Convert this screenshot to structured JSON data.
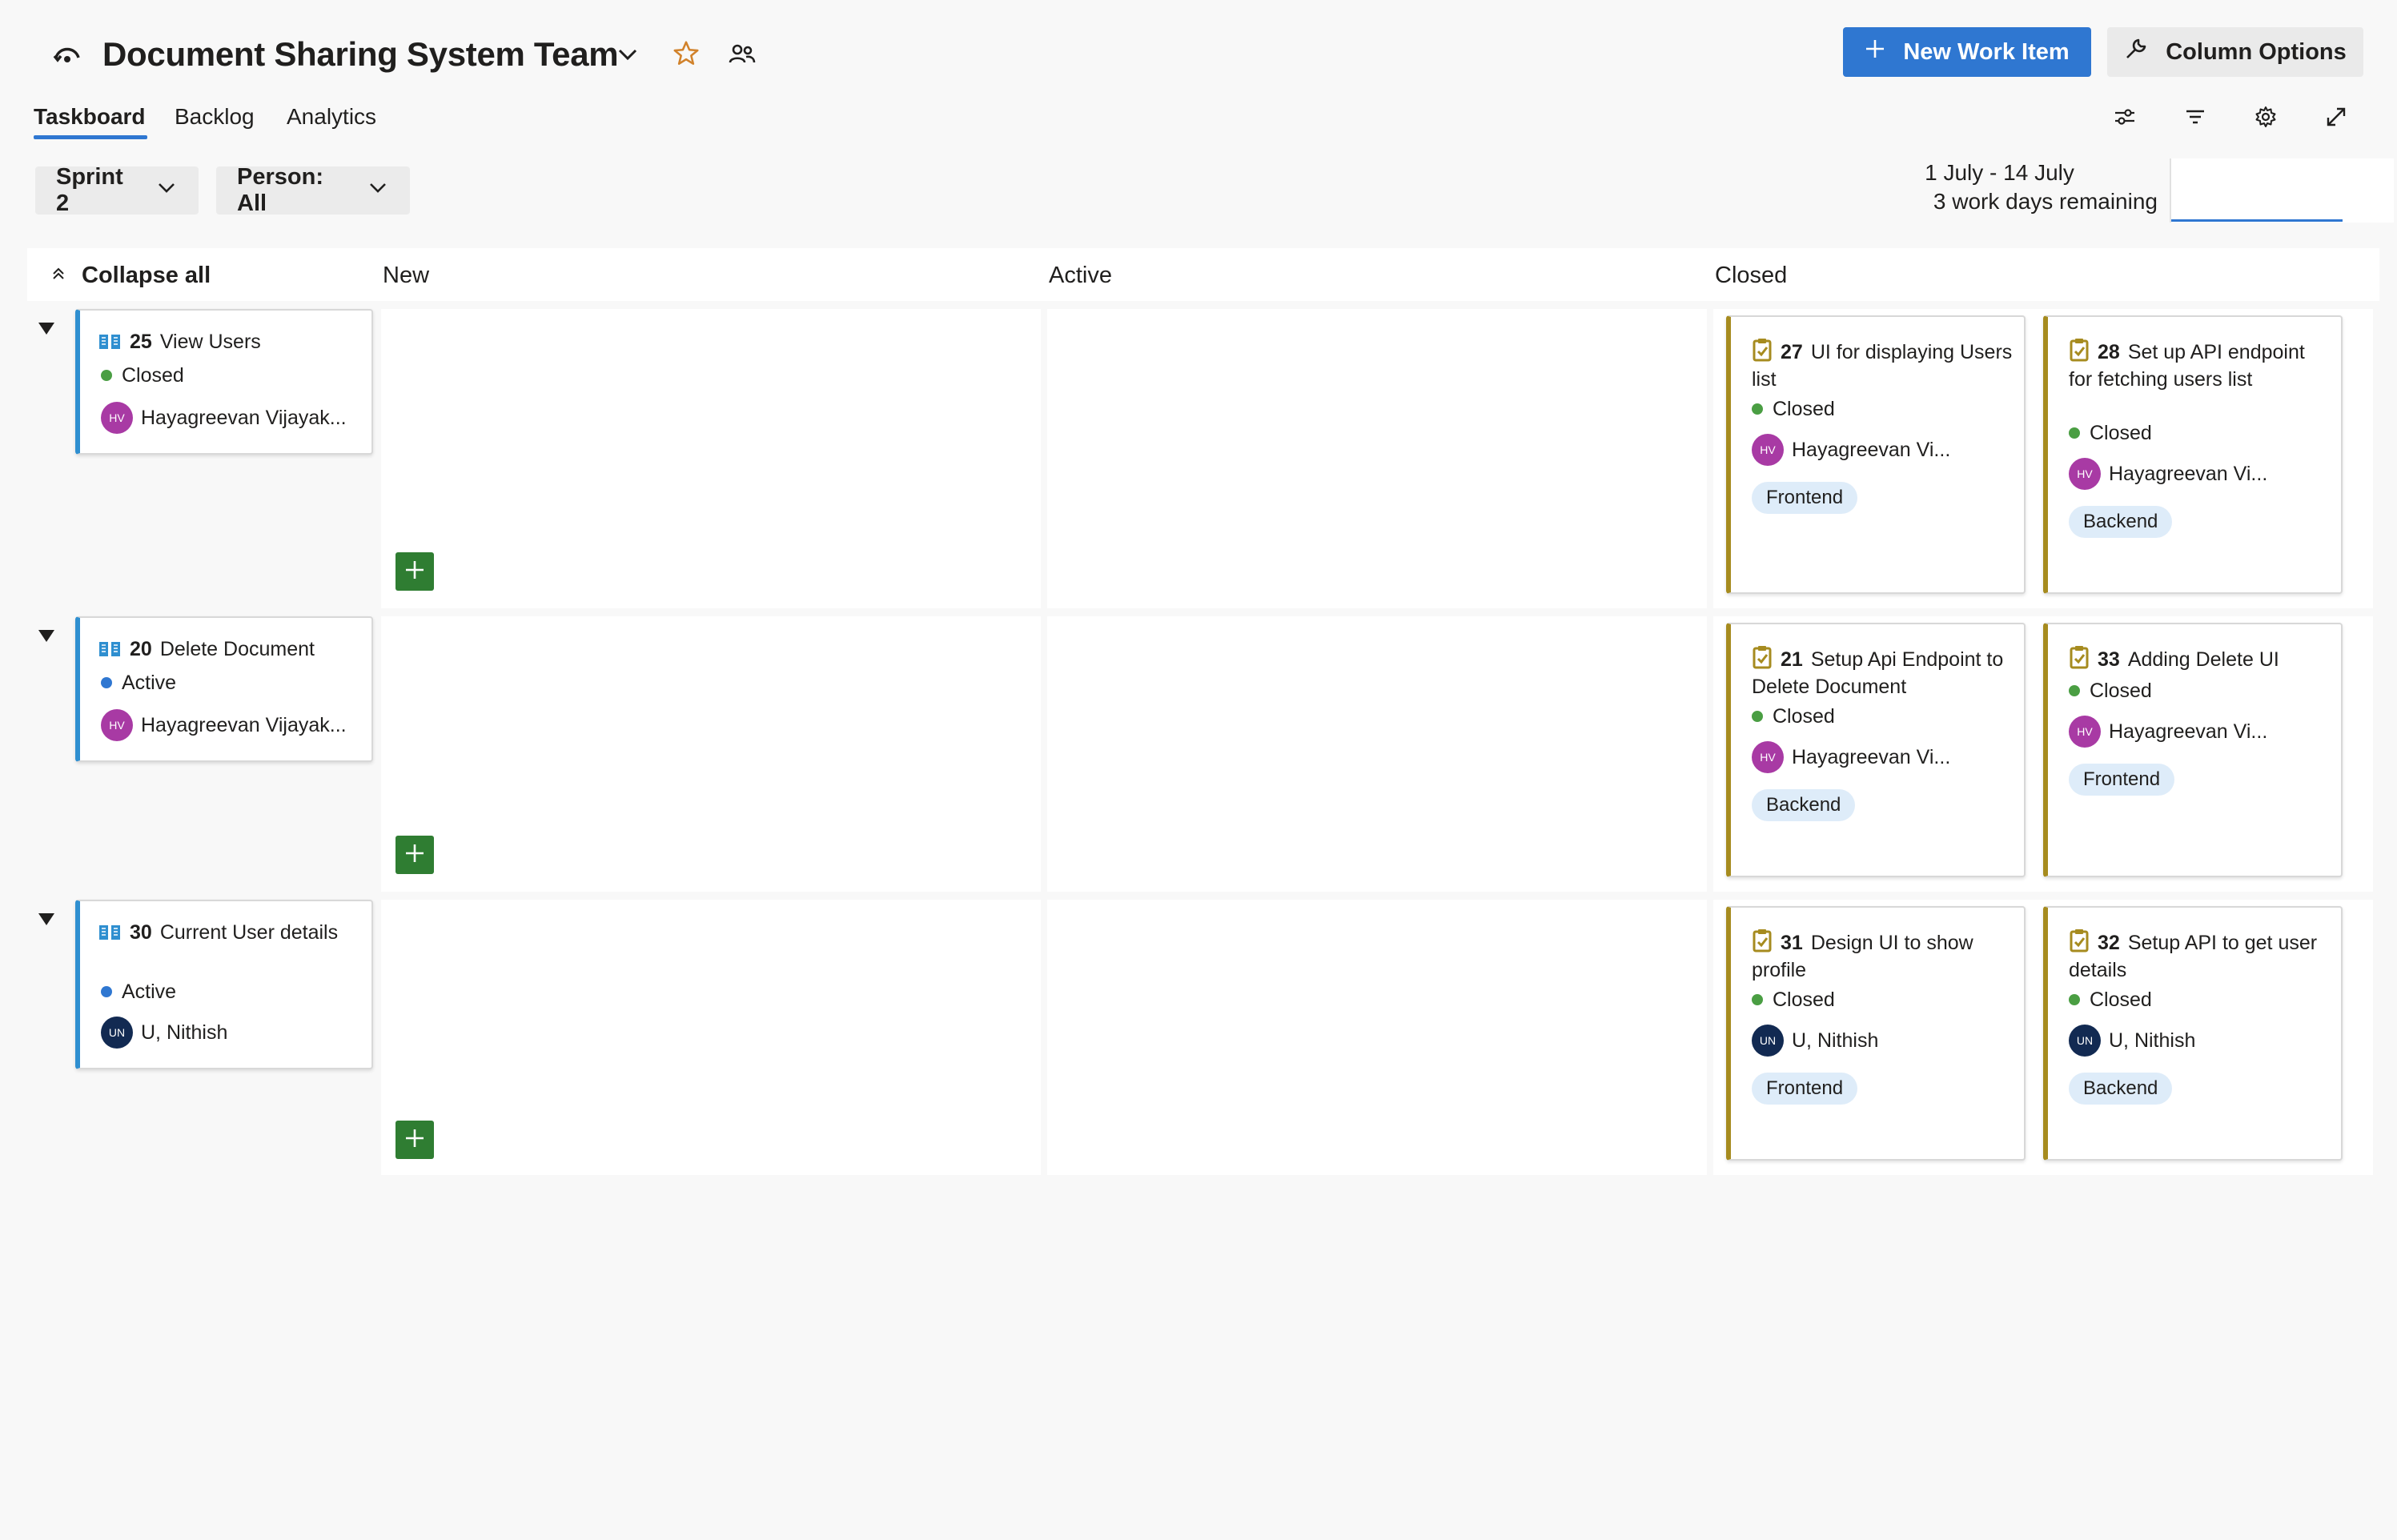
{
  "header": {
    "team_name": "Document Sharing System Team",
    "new_work_item": "New Work Item",
    "column_options": "Column Options"
  },
  "tabs": [
    "Taskboard",
    "Backlog",
    "Analytics"
  ],
  "filters": {
    "sprint": "Sprint 2",
    "person": "Person: All"
  },
  "sprint_info": {
    "dates": "1 July - 14 July",
    "remaining": "3 work days remaining"
  },
  "columns": {
    "collapse_all": "Collapse all",
    "new": "New",
    "active": "Active",
    "closed": "Closed"
  },
  "lanes": [
    {
      "parent": {
        "id": "25",
        "title": "View Users",
        "state": "Closed",
        "assignee": "Hayagreevan Vijayak...",
        "initials": "HV"
      },
      "tasks": [
        {
          "id": "27",
          "title": "UI for displaying Users list",
          "state": "Closed",
          "assignee": "Hayagreevan Vi...",
          "initials": "HV",
          "tag": "Frontend"
        },
        {
          "id": "28",
          "title": "Set up API endpoint for fetching users list",
          "state": "Closed",
          "assignee": "Hayagreevan Vi...",
          "initials": "HV",
          "tag": "Backend"
        }
      ]
    },
    {
      "parent": {
        "id": "20",
        "title": "Delete Document",
        "state": "Active",
        "assignee": "Hayagreevan Vijayak...",
        "initials": "HV"
      },
      "tasks": [
        {
          "id": "21",
          "title": "Setup Api Endpoint to Delete Document",
          "state": "Closed",
          "assignee": "Hayagreevan Vi...",
          "initials": "HV",
          "tag": "Backend"
        },
        {
          "id": "33",
          "title": "Adding Delete UI",
          "state": "Closed",
          "assignee": "Hayagreevan Vi...",
          "initials": "HV",
          "tag": "Frontend"
        }
      ]
    },
    {
      "parent": {
        "id": "30",
        "title": "Current User details",
        "state": "Active",
        "assignee": "U, Nithish",
        "initials": "UN"
      },
      "tasks": [
        {
          "id": "31",
          "title": "Design UI to show profile",
          "state": "Closed",
          "assignee": "U, Nithish",
          "initials": "UN",
          "tag": "Frontend"
        },
        {
          "id": "32",
          "title": "Setup API to get user details",
          "state": "Closed",
          "assignee": "U, Nithish",
          "initials": "UN",
          "tag": "Backend"
        }
      ]
    }
  ],
  "colors": {
    "accent": "#2f77d1",
    "pbi_border": "#2f8fd0",
    "task_border": "#a68b1f",
    "closed_dot": "#4a9e43",
    "active_dot": "#2f77d1",
    "add_button": "#2f7d32",
    "avatar_hv": "#a83aa4",
    "avatar_un": "#122a52"
  },
  "icons": {
    "team": "team-nav-icon",
    "chevron": "chevron-down-icon",
    "favorite": "star-outline-icon",
    "members": "people-icon",
    "new_item": "plus-icon",
    "column_options": "wrench-icon",
    "toolbar": [
      "sliders-icon",
      "filter-icon",
      "gear-icon",
      "fullscreen-icon"
    ],
    "lane_toggle": "caret-down-icon",
    "collapse": "double-chevron-up-icon",
    "pbi": "book-icon",
    "task": "clipboard-check-icon",
    "add": "plus-icon"
  }
}
